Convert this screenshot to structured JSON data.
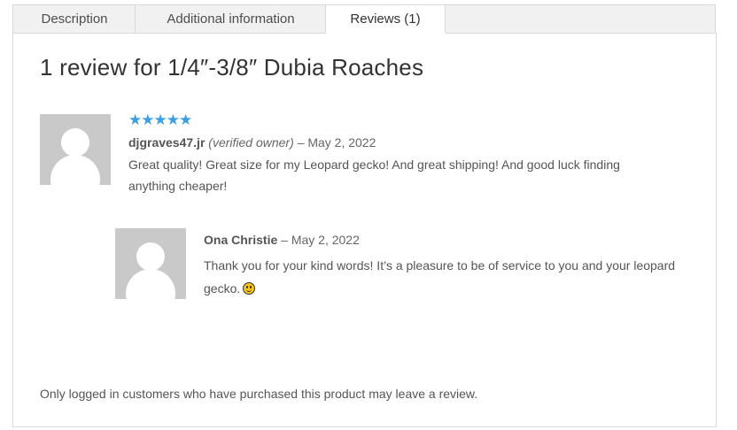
{
  "tabs": [
    {
      "label": "Description"
    },
    {
      "label": "Additional information"
    },
    {
      "label": "Reviews (1)"
    }
  ],
  "reviews": {
    "title": "1 review for 1/4″-3/8″ Dubia Roaches",
    "items": [
      {
        "rating_text": "★★★★★",
        "rating": 5,
        "author": "djgraves47.jr",
        "verified": "(verified owner)",
        "date": "– May 2, 2022",
        "text": "Great quality! Great size for my Leopard gecko! And great shipping! And good luck finding anything cheaper!"
      }
    ],
    "reply": {
      "author": "Ona Christie",
      "date": "– May 2, 2022",
      "text": "Thank you for your kind words! It’s a pleasure to be of service to you and your leopard gecko."
    },
    "notice": "Only logged in customers who have purchased this product may leave a review."
  },
  "colors": {
    "star": "#3e9fe0",
    "border": "#d9d9d9",
    "avatar_bg": "#c9c9c9"
  }
}
